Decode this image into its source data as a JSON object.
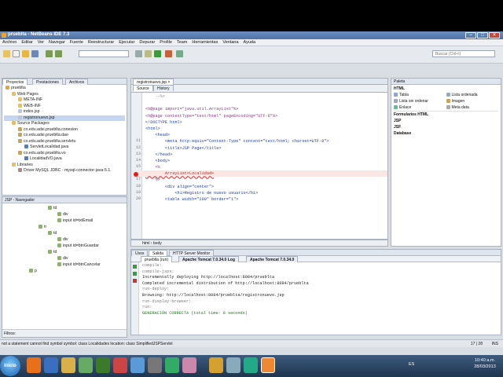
{
  "app": {
    "title": "prueblta - NetBeans IDE 7.3"
  },
  "menu": [
    "Archivo",
    "Editar",
    "Ver",
    "Navegar",
    "Fuente",
    "Reestructurar",
    "Ejecutar",
    "Depurar",
    "Profile",
    "Team",
    "Herramientas",
    "Ventana",
    "Ayuda"
  ],
  "search": {
    "placeholder": "Buscar (Ctrl+I)"
  },
  "left_tabs": [
    "Proyectos",
    "Prestaciones",
    "Archivos"
  ],
  "project_tree": [
    {
      "depth": 0,
      "label": "prueblta",
      "icon": "project"
    },
    {
      "depth": 1,
      "label": "Web Pages",
      "icon": "folder"
    },
    {
      "depth": 2,
      "label": "META-INF",
      "icon": "folder"
    },
    {
      "depth": 2,
      "label": "WEB-INF",
      "icon": "folder"
    },
    {
      "depth": 2,
      "label": "index.jsp",
      "icon": "file"
    },
    {
      "depth": 2,
      "label": "registronuevo.jsp",
      "icon": "file",
      "selected": true
    },
    {
      "depth": 1,
      "label": "Source Packages",
      "icon": "folder"
    },
    {
      "depth": 2,
      "label": "co.edu.adsi.prueblta.conexion",
      "icon": "package"
    },
    {
      "depth": 2,
      "label": "co.edu.adsi.prueblta.dao",
      "icon": "package"
    },
    {
      "depth": 2,
      "label": "co.edu.adsi.prueblta.servletu",
      "icon": "package"
    },
    {
      "depth": 3,
      "label": "ServletLocalidad.java",
      "icon": "java"
    },
    {
      "depth": 2,
      "label": "co.edu.adsi.prueblta.vo",
      "icon": "package"
    },
    {
      "depth": 3,
      "label": "LocalidadVO.java",
      "icon": "java"
    },
    {
      "depth": 1,
      "label": "Libraries",
      "icon": "folder"
    },
    {
      "depth": 2,
      "label": "Driver MySQL JDBC - mysql-connector-java-5.1.",
      "icon": "jar"
    }
  ],
  "navigator": {
    "title": "JSP - Navegador",
    "items": [
      {
        "depth": 3,
        "label": "td"
      },
      {
        "depth": 4,
        "label": "div"
      },
      {
        "depth": 4,
        "label": "input id=txtEmail"
      },
      {
        "depth": 2,
        "label": "tr"
      },
      {
        "depth": 3,
        "label": "td"
      },
      {
        "depth": 4,
        "label": "div"
      },
      {
        "depth": 4,
        "label": "input id=btnGuardar"
      },
      {
        "depth": 3,
        "label": "td"
      },
      {
        "depth": 4,
        "label": "div"
      },
      {
        "depth": 4,
        "label": "input id=btnCancelar"
      },
      {
        "depth": 1,
        "label": "p"
      }
    ],
    "filter_label": "Filtros:"
  },
  "editor": {
    "file_tab": "registronuevo.jsp",
    "tabs": [
      "Source",
      "History"
    ],
    "lines": [
      {
        "n": "",
        "code": "    --%>"
      },
      {
        "n": "",
        "code": ""
      },
      {
        "n": "",
        "code": "<%@page import=\"java.util.ArrayList\"%>"
      },
      {
        "n": "",
        "code": "<%@page contentType=\"text/html\" pageEncoding=\"UTF-8\"%>"
      },
      {
        "n": "",
        "code": "<!DOCTYPE html>"
      },
      {
        "n": "",
        "code": "<html>"
      },
      {
        "n": "",
        "code": "    <head>"
      },
      {
        "n": "11",
        "code": "        <meta http-equiv=\"Content-Type\" content=\"text/html; charset=UTF-8\">"
      },
      {
        "n": "12",
        "code": "        <title>JSP Page</title>"
      },
      {
        "n": "13",
        "code": "    </head>"
      },
      {
        "n": "14",
        "code": "    <body>"
      },
      {
        "n": "15",
        "code": "    <%"
      },
      {
        "n": "",
        "code": "        ArrayList<Localidad>"
      },
      {
        "n": "17",
        "code": "    %>"
      },
      {
        "n": "18",
        "code": "        <div align=\"center\">"
      },
      {
        "n": "19",
        "code": "            <h1>Registro de nuevo usuario</h1>"
      },
      {
        "n": "20",
        "code": "        <table width=\"200\" border=\"1\">"
      }
    ],
    "breadcrumbs": [
      "html",
      "body"
    ]
  },
  "palette": {
    "title": "Paleta",
    "sections": [
      "HTML",
      "Formularios HTML",
      "JSP",
      "JSF",
      "Database"
    ],
    "items_left": [
      "Tabla",
      "Lista ordenada",
      "Lista sin ordenar",
      "Enlace"
    ],
    "items_right": [
      "Lista ordenada",
      "Imagen",
      "Meta data"
    ]
  },
  "output": {
    "top_tabs": [
      "Usos",
      "Salida",
      "HTTP Server Monitor"
    ],
    "sub_tabs": [
      "prueblta (run)",
      "Apache Tomcat 7.0.34.0 Log",
      "Apache Tomcat 7.0.34.0"
    ],
    "lines": [
      {
        "text": "compile:",
        "color": "#7a7a7a"
      },
      {
        "text": "compile-jsps:",
        "color": "#7a7a7a"
      },
      {
        "text": "Incrementally deploying http://localhost:8084/prueblta",
        "color": "#222"
      },
      {
        "text": "Completed incremental distribution of http://localhost:8084/prueblta",
        "color": "#222"
      },
      {
        "text": "run-deploy:",
        "color": "#7a7a7a"
      },
      {
        "text": "Browsing: http://localhost:8084/prueblta/registronuevo.jsp",
        "color": "#222"
      },
      {
        "text": "run-display-browser:",
        "color": "#7a7a7a"
      },
      {
        "text": "run:",
        "color": "#7a7a7a"
      },
      {
        "text": "GENERACIÓN CORRECTA (total time: 8 seconds)",
        "color": "#1c7c1c"
      }
    ]
  },
  "status": {
    "message": "not a statement  cannot find symbol  symbol:  class Localidades  location: class SimplifiedJSPServlet",
    "position": "17 | 28",
    "mode": "INS"
  },
  "taskbar": {
    "start_label": "Inicio",
    "lang": "ES",
    "time": "10:40 a.m.",
    "date": "28/03/2013"
  }
}
